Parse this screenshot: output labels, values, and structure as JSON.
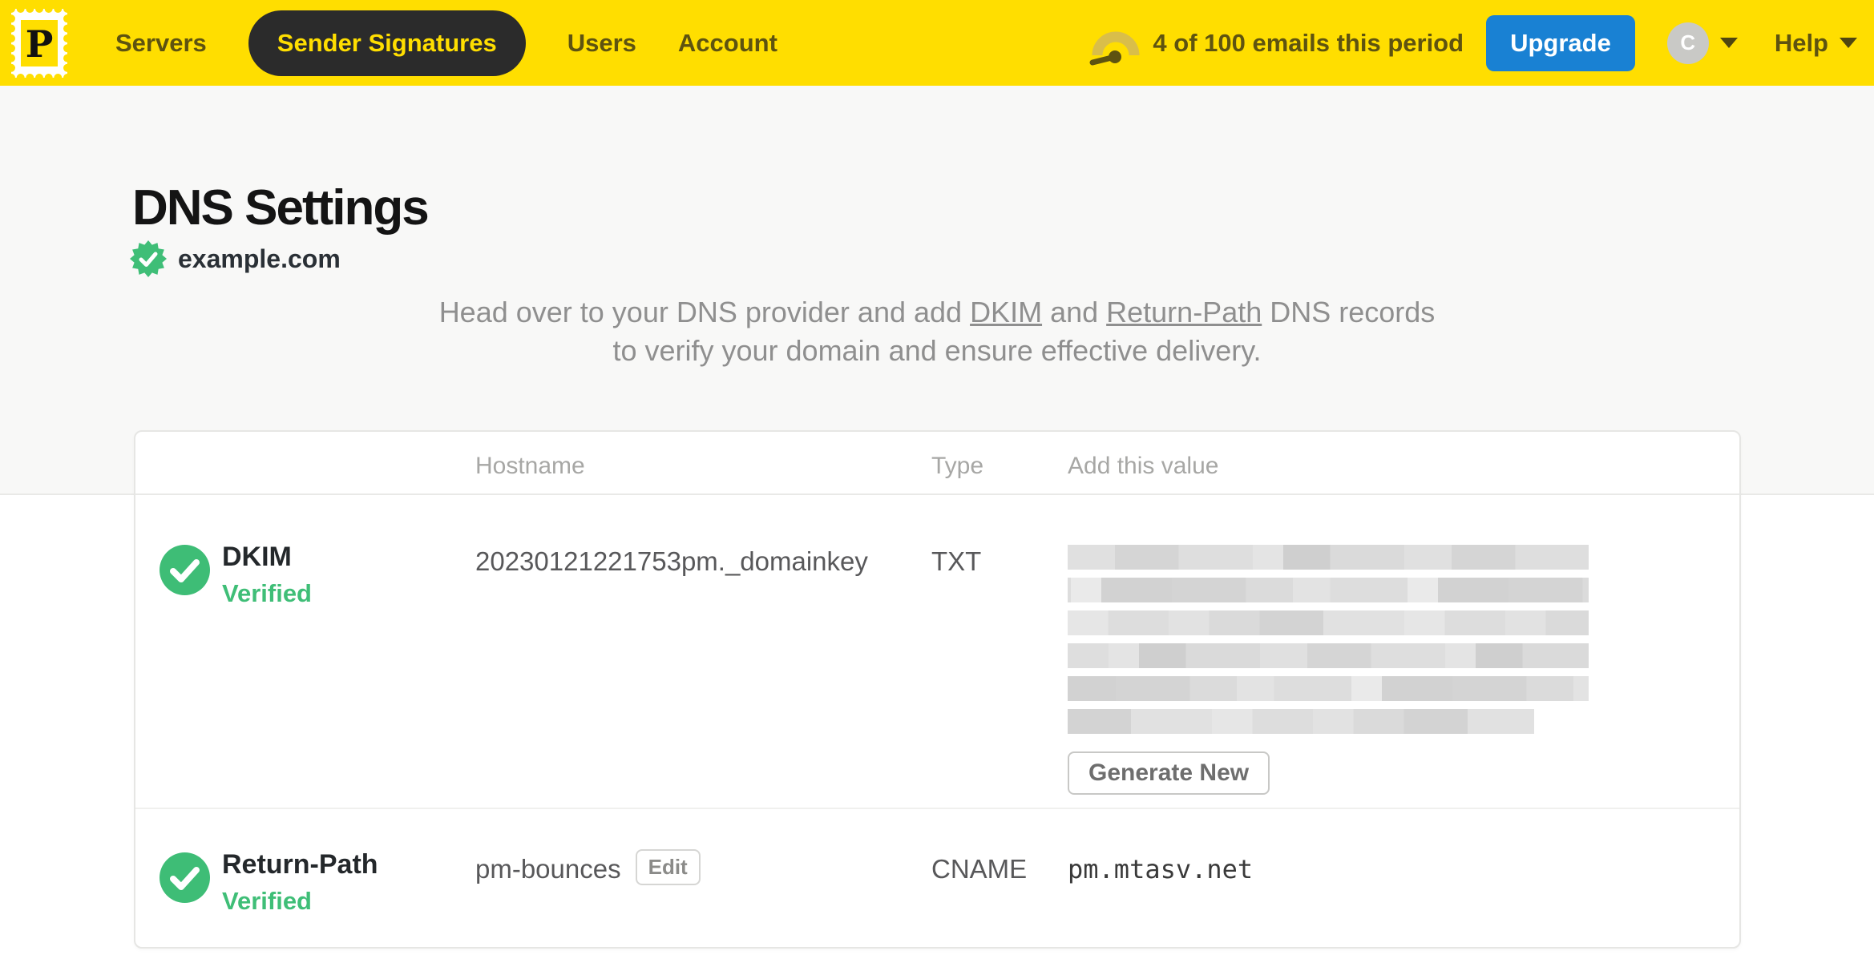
{
  "nav": {
    "logo_letter": "P",
    "items": [
      {
        "label": "Servers",
        "active": false
      },
      {
        "label": "Sender Signatures",
        "active": true
      },
      {
        "label": "Users",
        "active": false
      },
      {
        "label": "Account",
        "active": false
      }
    ],
    "usage_text": "4 of 100 emails this period",
    "upgrade_label": "Upgrade",
    "avatar_initial": "C",
    "help_label": "Help"
  },
  "page": {
    "title": "DNS Settings",
    "domain": "example.com",
    "description": {
      "before": "Head over to your DNS provider and add ",
      "link_dkim": "DKIM",
      "middle": " and ",
      "link_return_path": "Return-Path",
      "after": " DNS records to verify your domain and ensure effective delivery."
    }
  },
  "table": {
    "headers": {
      "hostname": "Hostname",
      "type": "Type",
      "value": "Add this value"
    },
    "rows": [
      {
        "name": "DKIM",
        "status": "Verified",
        "hostname": "20230121221753pm._domainkey",
        "type": "TXT",
        "value_redacted": true,
        "redacted_lines": 6,
        "action_label": "Generate New"
      },
      {
        "name": "Return-Path",
        "status": "Verified",
        "hostname": "pm-bounces",
        "edit_label": "Edit",
        "type": "CNAME",
        "value": "pm.mtasv.net"
      }
    ]
  },
  "colors": {
    "brand_yellow": "#FFDE00",
    "nav_text": "#5E5310",
    "pill_background": "#2B2B2B",
    "upgrade_blue": "#1981D3",
    "verified_green": "#3FBE77",
    "header_gray": "#A7A7A5"
  }
}
